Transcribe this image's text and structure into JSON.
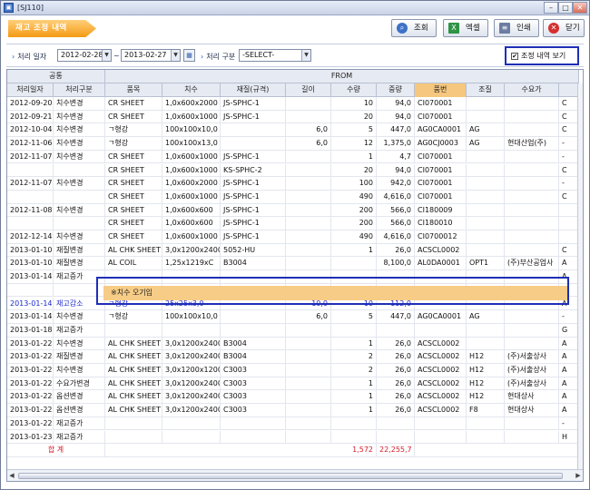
{
  "window": {
    "title": "[SJ110]"
  },
  "toolbar": {
    "screen_title": "재고 조정 내역",
    "buttons": [
      {
        "label": "조회",
        "icon": "search-icon"
      },
      {
        "label": "엑셀",
        "icon": "excel-icon"
      },
      {
        "label": "인쇄",
        "icon": "print-icon"
      },
      {
        "label": "닫기",
        "icon": "close-icon"
      }
    ]
  },
  "filter": {
    "date_label": "처리 일자",
    "date_from": "2012-02-28",
    "date_sep": "~",
    "date_to": "2013-02-27",
    "type_label": "처리 구분",
    "type_value": "-SELECT-",
    "show_checkbox_label": "조정 내역 보기",
    "show_checked": true
  },
  "grid": {
    "group_headers": [
      "공통",
      "FROM"
    ],
    "columns": [
      "처리일자",
      "처리구분",
      "품목",
      "치수",
      "재질(규격)",
      "길이",
      "수량",
      "중량",
      "품번",
      "조질",
      "수요가"
    ],
    "rows": [
      [
        "2012-09-20",
        "치수변경",
        "CR SHEET",
        "1,0x600x2000",
        "JS-SPHC-1",
        "",
        "10",
        "94,0",
        "CI070001",
        "",
        ""
      ],
      [
        "2012-09-21",
        "치수변경",
        "CR SHEET",
        "1,0x600x1000",
        "JS-SPHC-1",
        "",
        "20",
        "94,0",
        "CI070001",
        "",
        ""
      ],
      [
        "2012-10-04",
        "치수변경",
        "ㄱ형강",
        "100x100x10,0",
        "",
        "6,0",
        "5",
        "447,0",
        "AG0CA0001",
        "AG",
        ""
      ],
      [
        "2012-11-06",
        "치수변경",
        "ㄱ형강",
        "100x100x13,0",
        "",
        "6,0",
        "12",
        "1,375,0",
        "AG0CJ0003",
        "AG",
        "현대산업(주)"
      ],
      [
        "2012-11-07",
        "치수변경",
        "CR SHEET",
        "1,0x600x1000",
        "JS-SPHC-1",
        "",
        "1",
        "4,7",
        "CI070001",
        "",
        ""
      ],
      [
        "",
        "",
        "CR SHEET",
        "1,0x600x1000",
        "KS-SPHC-2",
        "",
        "20",
        "94,0",
        "CI070001",
        "",
        ""
      ],
      [
        "2012-11-07",
        "치수변경",
        "CR SHEET",
        "1,0x600x2000",
        "JS-SPHC-1",
        "",
        "100",
        "942,0",
        "CI070001",
        "",
        ""
      ],
      [
        "",
        "",
        "CR SHEET",
        "1,0x600x1000",
        "JS-SPHC-1",
        "",
        "490",
        "4,616,0",
        "CI070001",
        "",
        ""
      ],
      [
        "2012-11-08",
        "치수변경",
        "CR SHEET",
        "1,0x600x600",
        "JS-SPHC-1",
        "",
        "200",
        "566,0",
        "CI180009",
        "",
        ""
      ],
      [
        "",
        "",
        "CR SHEET",
        "1,0x600x600",
        "JS-SPHC-1",
        "",
        "200",
        "566,0",
        "CI180010",
        "",
        ""
      ],
      [
        "2012-12-14",
        "치수변경",
        "CR SHEET",
        "1,0x600x1000",
        "JS-SPHC-1",
        "",
        "490",
        "4,616,0",
        "CI0700012",
        "",
        ""
      ],
      [
        "2013-01-10",
        "재질변경",
        "AL CHK SHEET",
        "3,0x1200x2400",
        "5052-HU",
        "",
        "1",
        "26,0",
        "ACSCL0002",
        "",
        ""
      ],
      [
        "2013-01-10",
        "재질변경",
        "AL COIL",
        "1,25x1219xC",
        "B3004",
        "",
        "",
        "8,100,0",
        "AL0DA0001",
        "OPT1",
        "(주)부산공업사"
      ],
      [
        "2013-01-14",
        "재고증가",
        "",
        "",
        "",
        "",
        "",
        "",
        "",
        "",
        ""
      ],
      [
        "",
        "",
        "",
        "",
        "",
        "",
        "",
        "",
        "",
        "",
        ""
      ],
      [
        "2013-01-14",
        "재고감소",
        "ㄱ형강",
        "25x25x3,0",
        "",
        "10,0",
        "10",
        "112,0",
        "",
        "",
        ""
      ],
      [
        "2013-01-14",
        "치수변경",
        "ㄱ형강",
        "100x100x10,0",
        "",
        "6,0",
        "5",
        "447,0",
        "AG0CA0001",
        "AG",
        ""
      ],
      [
        "2013-01-18",
        "재고증가",
        "",
        "",
        "",
        "",
        "",
        "",
        "",
        "",
        ""
      ],
      [
        "2013-01-22",
        "치수변경",
        "AL CHK SHEET",
        "3,0x1200x2400",
        "B3004",
        "",
        "1",
        "26,0",
        "ACSCL0002",
        "",
        ""
      ],
      [
        "2013-01-22",
        "재질변경",
        "AL CHK SHEET",
        "3,0x1200x2400",
        "B3004",
        "",
        "2",
        "26,0",
        "ACSCL0002",
        "H12",
        "(주)서출상사"
      ],
      [
        "2013-01-22",
        "치수변경",
        "AL CHK SHEET",
        "3,0x1200x1200",
        "C3003",
        "",
        "2",
        "26,0",
        "ACSCL0002",
        "H12",
        "(주)서출상사"
      ],
      [
        "2013-01-22",
        "수요가변경",
        "AL CHK SHEET",
        "3,0x1200x2400",
        "C3003",
        "",
        "1",
        "26,0",
        "ACSCL0002",
        "H12",
        "(주)서출상사"
      ],
      [
        "2013-01-22",
        "옵션변경",
        "AL CHK SHEET",
        "3,0x1200x2400",
        "C3003",
        "",
        "1",
        "26,0",
        "ACSCL0002",
        "H12",
        "현대상사"
      ],
      [
        "2013-01-22",
        "옵션변경",
        "AL CHK SHEET",
        "3,0x1200x2400",
        "C3003",
        "",
        "1",
        "26,0",
        "ACSCL0002",
        "F8",
        "현대상사"
      ],
      [
        "2013-01-22",
        "재고증가",
        "",
        "",
        "",
        "",
        "",
        "",
        "",
        "",
        ""
      ],
      [
        "2013-01-23",
        "재고증가",
        "",
        "",
        "",
        "",
        "",
        "",
        "",
        "",
        ""
      ]
    ],
    "overlay_note": "※치수 오기입",
    "overflow_letters": [
      "C",
      "C",
      "C",
      "-",
      "-",
      "C",
      "-",
      "C",
      "",
      "",
      "",
      "C",
      "A",
      "A",
      "",
      "A",
      "-",
      "G",
      "A",
      "A",
      "A",
      "A",
      "A",
      "A",
      "-",
      "H"
    ],
    "total_label": "합 계",
    "total_qty": "1,572",
    "total_weight": "22,255,7"
  }
}
